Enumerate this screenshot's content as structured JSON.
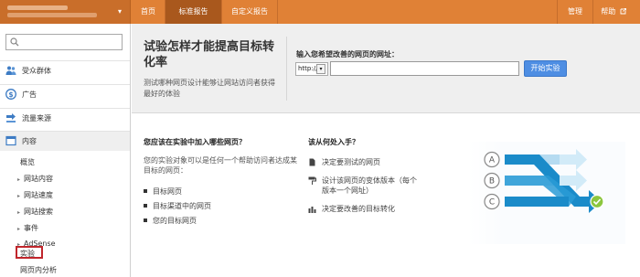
{
  "topbar": {
    "nav": [
      "首页",
      "标准报告",
      "自定义报告"
    ],
    "admin": "管理",
    "help": "帮助",
    "help_ext_icon": "external-link-icon"
  },
  "sidebar": {
    "search_icon": "search-icon",
    "sections": [
      {
        "label": "受众群体",
        "icon": "audience-icon"
      },
      {
        "label": "广告",
        "icon": "dollar-icon"
      },
      {
        "label": "流量来源",
        "icon": "traffic-sources-icon"
      },
      {
        "label": "内容",
        "icon": "content-icon"
      }
    ],
    "content_items": [
      "概览",
      "网站内容",
      "网站速度",
      "网站搜索",
      "事件",
      "AdSense",
      "实验",
      "网页内分析"
    ]
  },
  "hero": {
    "title": "试验怎样才能提高目标转化率",
    "description": "测试哪种网页设计能够让网站访问者获得最好的体验",
    "input_label": "输入您希望改善的网页的网址：",
    "protocol_value": "http://",
    "url_value": "",
    "start_button": "开始实验"
  },
  "left_col": {
    "heading": "您应该在实验中加入哪些网页？",
    "paragraph": "您的实验对象可以是任何一个帮助访问者达成某目标的网页：",
    "bullets": [
      "目标网页",
      "目标渠道中的网页",
      "您的目标网页"
    ]
  },
  "right_col": {
    "heading": "该从何处入手？",
    "steps": [
      "决定要测试的网页",
      "设计该网页的变体版本（每个版本一个网址）",
      "决定要改善的目标转化"
    ]
  },
  "illustration": {
    "labels": [
      "A",
      "B",
      "C"
    ],
    "colors": {
      "accent": "#1a8bc9",
      "light": "#8fc9ea",
      "check": "#8cc63f"
    }
  },
  "colors": {
    "topbar": "#e08136",
    "active_tab": "#a9581d",
    "button": "#4e8ee3",
    "highlight_box": "#c0262c"
  }
}
